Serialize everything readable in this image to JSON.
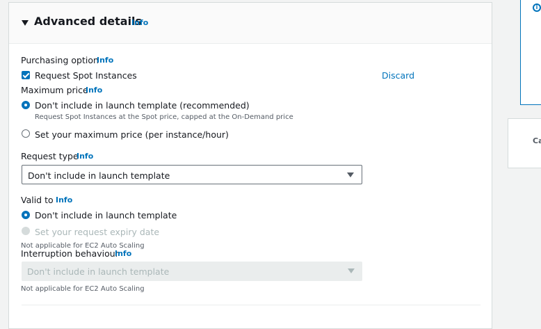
{
  "section": {
    "title": "Advanced details",
    "info": "Info"
  },
  "purchasing_option": {
    "label": "Purchasing option",
    "info": "Info",
    "checkbox_label": "Request Spot Instances",
    "checked": true,
    "discard": "Discard"
  },
  "maximum_price": {
    "label": "Maximum price",
    "info": "Info",
    "options": [
      {
        "label": "Don't include in launch template (recommended)",
        "description": "Request Spot Instances at the Spot price, capped at the On-Demand price",
        "selected": true
      },
      {
        "label": "Set your maximum price (per instance/hour)",
        "selected": false
      }
    ]
  },
  "request_type": {
    "label": "Request type",
    "info": "Info",
    "value": "Don't include in launch template"
  },
  "valid_to": {
    "label": "Valid to",
    "info": "Info",
    "options": [
      {
        "label": "Don't include in launch template",
        "selected": true
      },
      {
        "label": "Set your request expiry date",
        "selected": false,
        "disabled": true
      }
    ],
    "note": "Not applicable for EC2 Auto Scaling"
  },
  "interruption_behaviour": {
    "label": "Interruption behaviour",
    "info": "Info",
    "value": "Don't include in launch template",
    "note": "Not applicable for EC2 Auto Scaling"
  },
  "side_panel": {
    "card_text": "Ca"
  },
  "colors": {
    "accent": "#0073bb",
    "text": "#16191f",
    "muted": "#545b64",
    "disabled": "#aab7b8"
  }
}
